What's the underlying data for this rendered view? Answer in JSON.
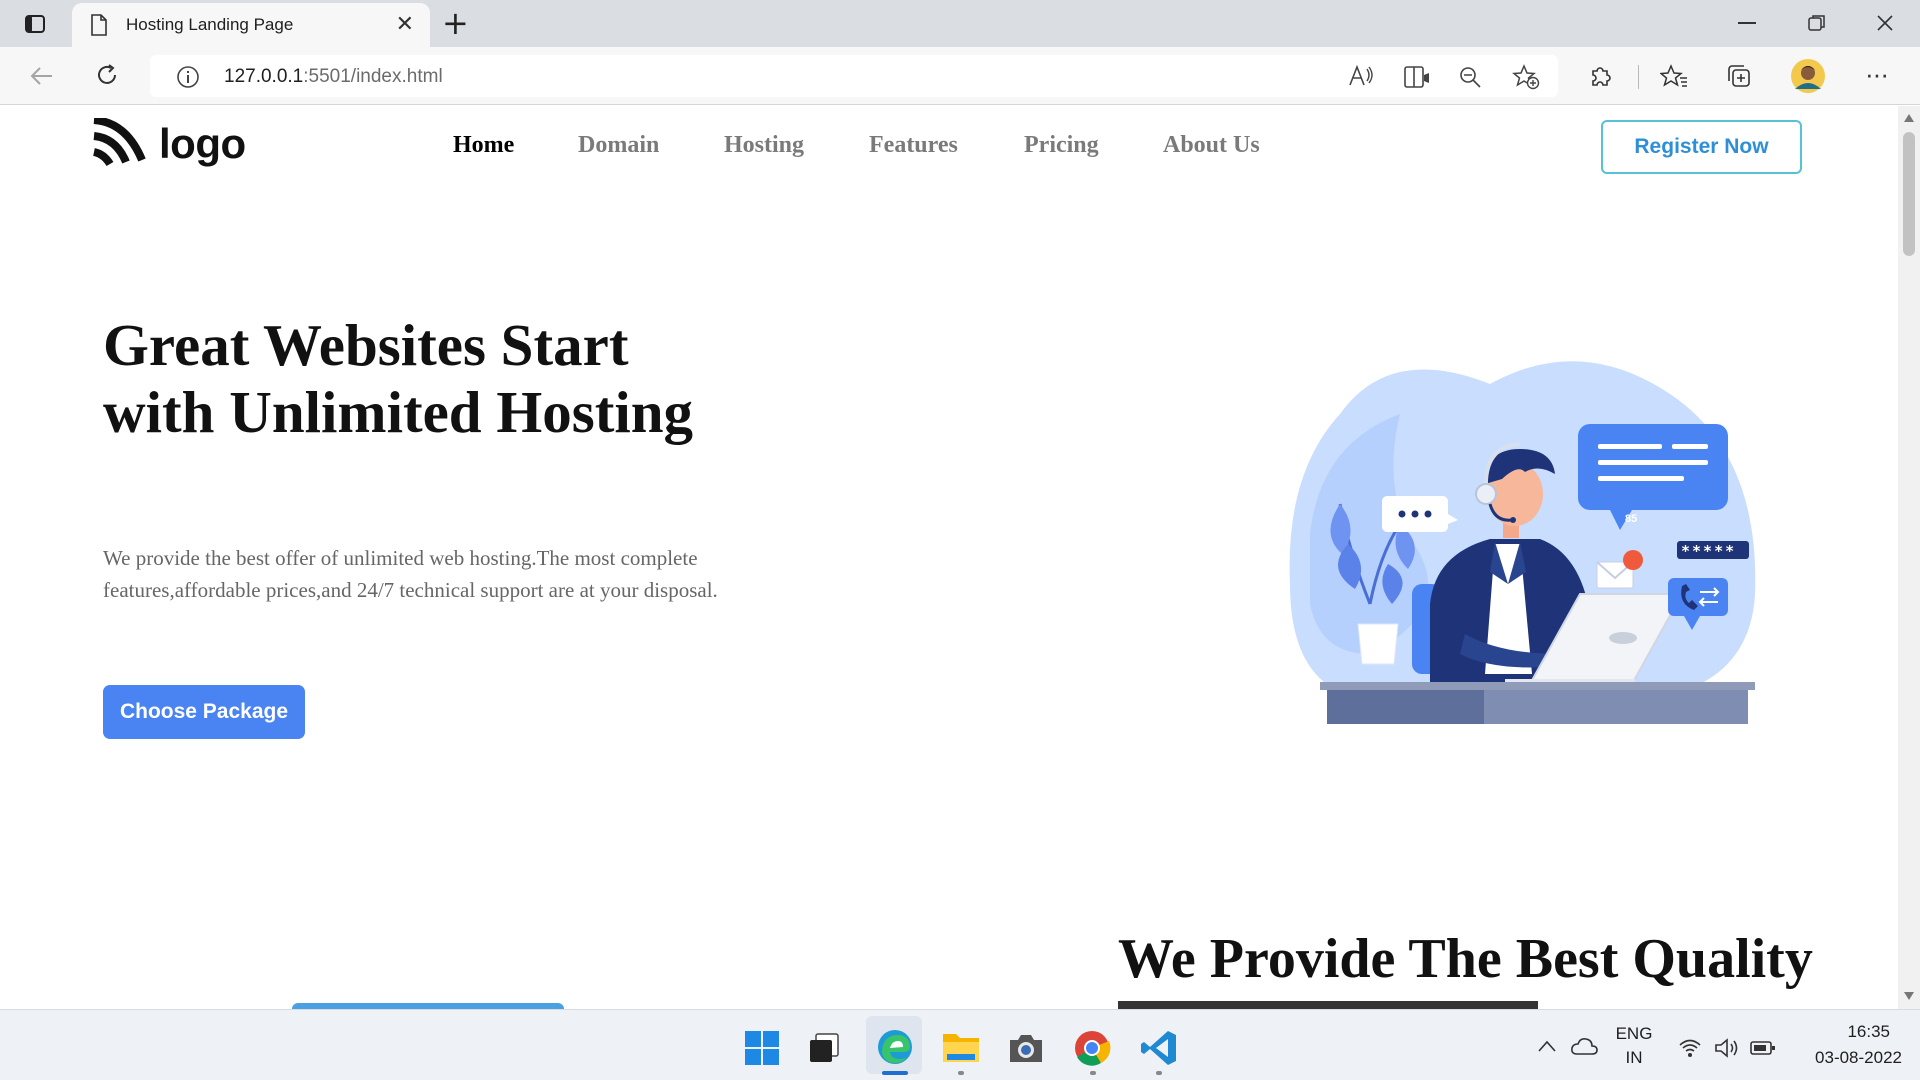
{
  "browser": {
    "tab_title": "Hosting Landing Page",
    "url_host": "127.0.0.1",
    "url_rest": ":5501/index.html"
  },
  "site": {
    "logo_text": "logo",
    "nav": [
      {
        "label": "Home",
        "active": true
      },
      {
        "label": "Domain",
        "active": false
      },
      {
        "label": "Hosting",
        "active": false
      },
      {
        "label": "Features",
        "active": false
      },
      {
        "label": "Pricing",
        "active": false
      },
      {
        "label": "About Us",
        "active": false
      }
    ],
    "register_label": "Register Now",
    "hero": {
      "title": "Great Websites Start with Unlimited Hosting",
      "description": "We provide the best offer of unlimited web hosting.The most complete features,affordable prices,and 24/7 technical support are at your disposal.",
      "cta_label": "Choose Package"
    },
    "illustration": {
      "badge_count": "85",
      "password_mask": "*****"
    },
    "section2_title": "We Provide The Best Quality"
  },
  "taskbar": {
    "language_top": "ENG",
    "language_bottom": "IN",
    "time": "16:35",
    "date": "03-08-2022"
  },
  "colors": {
    "accent": "#4a84f3",
    "register_border": "#55c2d6",
    "illustration_blue": "#bcd6ff",
    "navy": "#1f3478"
  }
}
